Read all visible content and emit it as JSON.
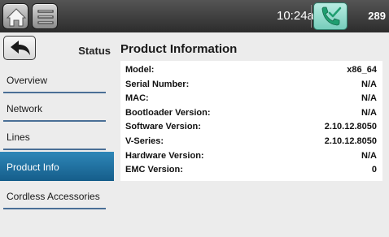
{
  "topbar": {
    "home_icon": "home-icon",
    "menu_icon": "list-menu-icon",
    "time": "10:24am",
    "phone_icon": "phone-checkmark-icon",
    "extension": "289",
    "phone_accent": "#76cdbb"
  },
  "nav": {
    "back_icon": "back-arrow-icon",
    "section": "Status",
    "items": [
      {
        "label": "Overview",
        "active": false
      },
      {
        "label": "Network",
        "active": false
      },
      {
        "label": "Lines",
        "active": false
      },
      {
        "label": "Product Info",
        "active": true
      },
      {
        "label": "Cordless Accessories",
        "active": false
      }
    ],
    "active_color": "#1f72a3"
  },
  "main": {
    "title": "Product Information",
    "rows": [
      {
        "label": "Model:",
        "value": "x86_64"
      },
      {
        "label": "Serial Number:",
        "value": "N/A"
      },
      {
        "label": "MAC:",
        "value": "N/A"
      },
      {
        "label": "Bootloader Version:",
        "value": "N/A"
      },
      {
        "label": "Software Version:",
        "value": "2.10.12.8050"
      },
      {
        "label": "V-Series:",
        "value": "2.10.12.8050"
      },
      {
        "label": "Hardware Version:",
        "value": "N/A"
      },
      {
        "label": "EMC Version:",
        "value": "0"
      }
    ]
  }
}
